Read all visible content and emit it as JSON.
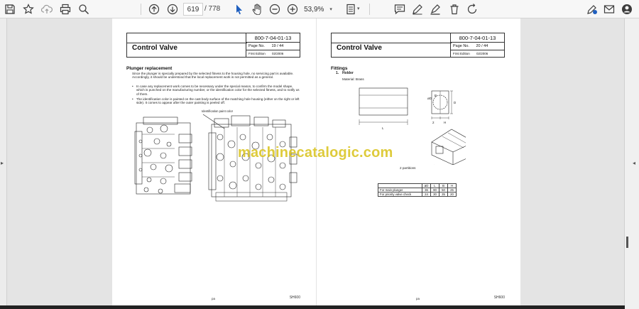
{
  "toolbar": {
    "current_page": "619",
    "total_pages": "/ 778",
    "zoom": "53,9%",
    "icons": [
      "save-icon",
      "bookmark-star-icon",
      "upload-cloud-icon",
      "print-icon",
      "zoom-search-icon",
      "page-up-icon",
      "page-down-icon",
      "select-cursor-icon",
      "hand-icon",
      "zoom-out-icon",
      "zoom-in-icon",
      "page-fit-icon",
      "comment-icon",
      "pen-icon",
      "highlight-icon",
      "delete-icon",
      "rotate-icon",
      "sign-icon",
      "mail-icon",
      "account-icon"
    ]
  },
  "left_page": {
    "doc_no": "800-7-04-01-13",
    "title": "Control Valve",
    "page_label": "Page No.",
    "page_no": "19 / 44",
    "edition_label": "First Edition",
    "edition_date": "02/2006",
    "section": "Plunger replacement",
    "para1": "Since the plunger is specially prepared by the selected fitness to the housing hole, no servicing part is available. Accordingly, it should be understood that the local replacement work is not permitted as a general.",
    "bullet1": "In case any replacement work comes to be necessary under the special reason, to confirm the model shape, which is punched on the manufacturing number, or the identification color for the selected fitness, and to notify us of them.",
    "bullet2": "The identification color is painted on the cast body surface of the matching hole housing (either on the right or left side). It comes to appear after the outer painting is peeled off.",
    "callout": "Identification paint color",
    "footer_left": "pa",
    "footer_right": "SH600"
  },
  "right_page": {
    "doc_no": "800-7-04-01-13",
    "title": "Control Valve",
    "page_label": "Page No.",
    "page_no": "20 / 44",
    "edition_label": "First Edition",
    "edition_date": "02/2006",
    "section": "Fittings",
    "item_no": "1.",
    "item_title": "Holder",
    "material": "Material: Brass",
    "partitions_label": "2 partitions",
    "dim_labels": {
      "length": "L",
      "diameter": "øD",
      "height": "H",
      "width": "2",
      "B": "B",
      "D": "D"
    },
    "table": {
      "headers": [
        "",
        "øD",
        "L",
        "B",
        "H"
      ],
      "rows": [
        {
          "label": "For main plunger",
          "values": [
            "36",
            "90",
            "50",
            "25"
          ]
        },
        {
          "label": "For priority valve check",
          "values": [
            "24",
            "30",
            "35",
            "20"
          ]
        }
      ]
    },
    "footer_left": "pa",
    "footer_right": "SH600"
  },
  "watermark": "machinecatalogic.com"
}
